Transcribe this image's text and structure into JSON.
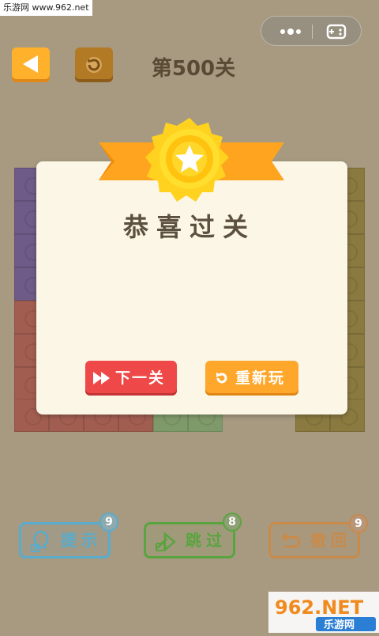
{
  "watermark_top": "乐游网 www.962.net",
  "header": {
    "level_title": "第500关"
  },
  "dialog": {
    "title": "恭喜过关",
    "next_label": "下一关",
    "replay_label": "重新玩"
  },
  "bottom_bar": {
    "hint": {
      "label": "提示",
      "count": "9",
      "color": "#5aaccc"
    },
    "skip": {
      "label": "跳过",
      "count": "8",
      "color": "#5aa43f"
    },
    "undo": {
      "label": "撤回",
      "count": "9",
      "color": "#c98a4a"
    }
  },
  "watermark_bottom": {
    "brand": "962.NET",
    "sub": "乐游网"
  },
  "icons": {
    "back": "back-arrow-icon",
    "restart": "restart-icon",
    "more": "more-dots-icon",
    "gamepad": "gamepad-icon",
    "star": "star-icon",
    "fast_forward": "fast-forward-icon",
    "replay": "replay-icon",
    "lightbulb": "lightbulb-icon",
    "skip": "skip-icon",
    "undo": "undo-icon"
  }
}
